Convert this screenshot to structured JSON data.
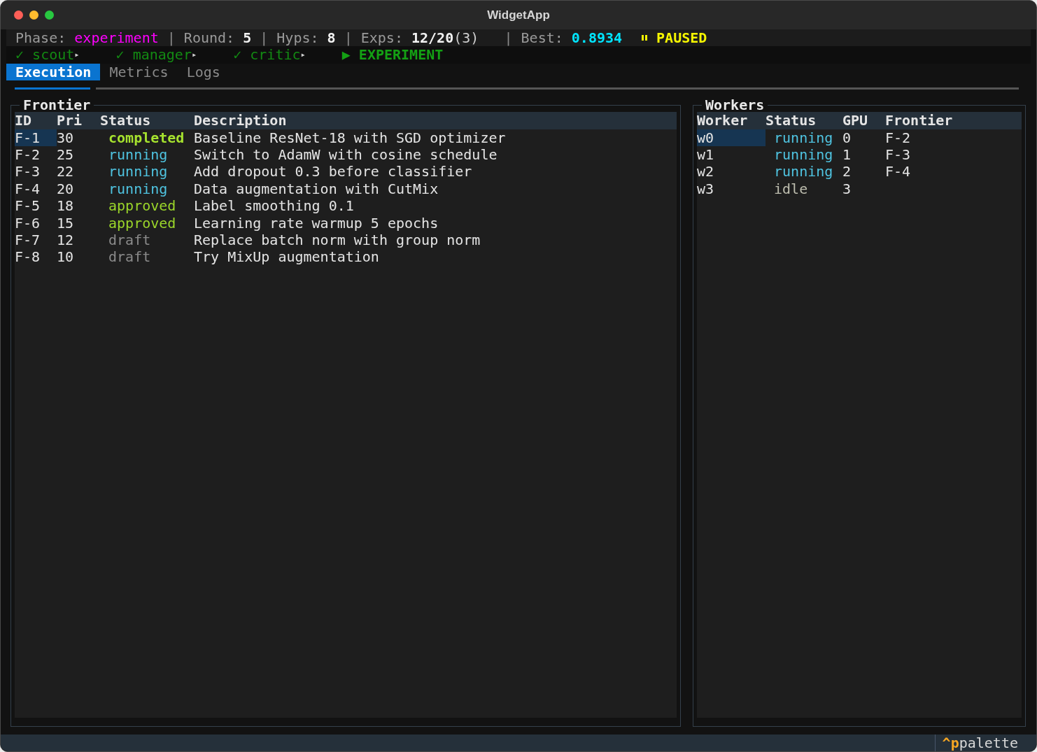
{
  "window": {
    "title": "WidgetApp"
  },
  "status_bar": {
    "items": [
      {
        "kind": "phase",
        "label": "Phase:",
        "value": "experiment"
      },
      {
        "kind": "count",
        "separator": "|",
        "label": "Round:",
        "value": "5"
      },
      {
        "kind": "count",
        "separator": "|",
        "label": "Hyps:",
        "value": "8"
      },
      {
        "kind": "count",
        "separator": "|",
        "label": "Exps:",
        "value": "12/20",
        "extra": "(3)"
      },
      {
        "kind": "score",
        "separator": "|",
        "label": "Best:",
        "value": "0.8934"
      }
    ],
    "state": {
      "paused": true,
      "text": "PAUSED"
    }
  },
  "pipeline": [
    {
      "kind": "done",
      "mark": "✓",
      "name": "scout",
      "arrow": "▸"
    },
    {
      "kind": "done",
      "mark": "✓",
      "name": "manager",
      "arrow": "▸"
    },
    {
      "kind": "done",
      "mark": "✓",
      "name": "critic",
      "arrow": "▸"
    },
    {
      "kind": "current",
      "mark": "▶",
      "name": "EXPERIMENT"
    }
  ],
  "tabs": [
    {
      "label": "Execution",
      "selected": true
    },
    {
      "label": "Metrics",
      "selected": false
    },
    {
      "label": "Logs",
      "selected": false
    }
  ],
  "frontier": {
    "title": "Frontier",
    "columns": [
      "ID",
      "Pri",
      "Status",
      "Description"
    ],
    "rows": [
      {
        "id": "F-1",
        "pri": "30",
        "status": "completed",
        "kind": "completed",
        "description": "Baseline ResNet-18 with SGD optimizer",
        "selected": true
      },
      {
        "id": "F-2",
        "pri": "25",
        "status": "running",
        "kind": "running",
        "description": "Switch to AdamW with cosine schedule",
        "selected": false
      },
      {
        "id": "F-3",
        "pri": "22",
        "status": "running",
        "kind": "running",
        "description": "Add dropout 0.3 before classifier",
        "selected": false
      },
      {
        "id": "F-4",
        "pri": "20",
        "status": "running",
        "kind": "running",
        "description": "Data augmentation with CutMix",
        "selected": false
      },
      {
        "id": "F-5",
        "pri": "18",
        "status": "approved",
        "kind": "approved",
        "description": "Label smoothing 0.1",
        "selected": false
      },
      {
        "id": "F-6",
        "pri": "15",
        "status": "approved",
        "kind": "approved",
        "description": "Learning rate warmup 5 epochs",
        "selected": false
      },
      {
        "id": "F-7",
        "pri": "12",
        "status": "draft",
        "kind": "draft",
        "description": "Replace batch norm with group norm",
        "selected": false
      },
      {
        "id": "F-8",
        "pri": "10",
        "status": "draft",
        "kind": "draft",
        "description": "Try MixUp augmentation",
        "selected": false
      }
    ]
  },
  "workers": {
    "title": "Workers",
    "columns": [
      "Worker",
      "Status",
      "GPU",
      "Frontier"
    ],
    "rows": [
      {
        "worker": "w0",
        "status": "running",
        "kind": "running",
        "gpu": "0",
        "frontier": "F-2",
        "selected": true
      },
      {
        "worker": "w1",
        "status": "running",
        "kind": "running",
        "gpu": "1",
        "frontier": "F-3",
        "selected": false
      },
      {
        "worker": "w2",
        "status": "running",
        "kind": "running",
        "gpu": "2",
        "frontier": "F-4",
        "selected": false
      },
      {
        "worker": "w3",
        "status": "idle",
        "kind": "idle",
        "gpu": "3",
        "selected": false
      }
    ]
  },
  "footer": {
    "key": "^p",
    "action": "palette"
  }
}
